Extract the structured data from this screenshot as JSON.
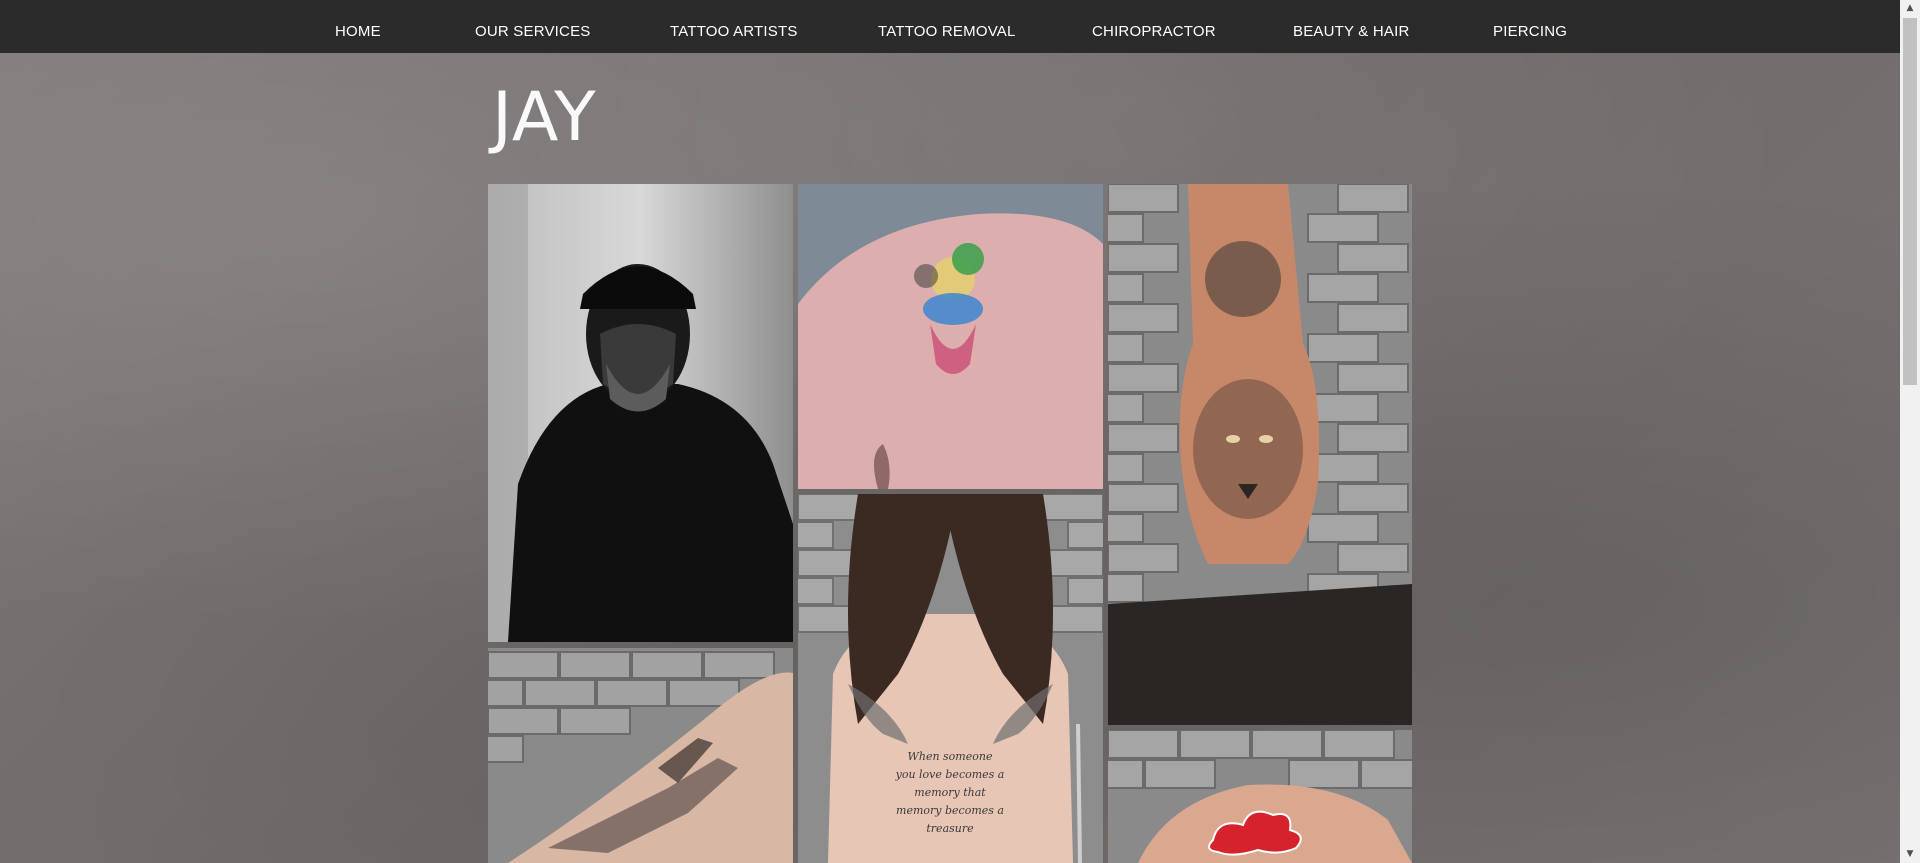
{
  "nav": {
    "items": [
      {
        "label": "HOME"
      },
      {
        "label": "OUR SERVICES"
      },
      {
        "label": "TATTOO ARTISTS"
      },
      {
        "label": "TATTOO REMOVAL"
      },
      {
        "label": "CHIROPRACTOR"
      },
      {
        "label": "BEAUTY & HAIR"
      },
      {
        "label": "PIERCING"
      }
    ]
  },
  "page": {
    "title": "JAY"
  },
  "gallery": {
    "items": [
      {
        "subject": "artist-portrait"
      },
      {
        "subject": "mickey-watercolor-shoulder-tattoo"
      },
      {
        "subject": "lion-rose-hand-tattoo"
      },
      {
        "subject": "script-wings-back-tattoo"
      },
      {
        "subject": "fighter-plane-arm-tattoo"
      },
      {
        "subject": "red-cloud-shoulder-tattoo"
      }
    ],
    "script_lines": [
      "When someone",
      "you love becomes a",
      "memory that",
      "memory becomes a",
      "treasure"
    ]
  },
  "scrollbar": {
    "up_icon": "arrow-up-icon",
    "down_icon": "arrow-down-icon",
    "position": 0.0
  },
  "colors": {
    "nav_bg": "#2b2b2b",
    "nav_text": "#ffffff",
    "page_bg": "#7a7675",
    "title": "#ffffff"
  }
}
